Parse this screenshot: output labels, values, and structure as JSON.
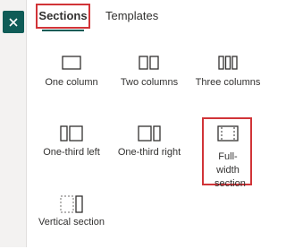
{
  "rail": {
    "close_label": "×"
  },
  "tabs": [
    {
      "label": "Sections",
      "selected": true
    },
    {
      "label": "Templates",
      "selected": false
    }
  ],
  "tiles": [
    {
      "label": "One column",
      "icon": "one-column-icon"
    },
    {
      "label": "Two columns",
      "icon": "two-columns-icon"
    },
    {
      "label": "Three columns",
      "icon": "three-columns-icon"
    },
    {
      "label": "One-third left",
      "icon": "one-third-left-icon"
    },
    {
      "label": "One-third right",
      "icon": "one-third-right-icon"
    },
    {
      "label": "Full-width section",
      "icon": "full-width-section-icon",
      "highlighted": true
    },
    {
      "label": "Vertical section",
      "icon": "vertical-section-icon"
    }
  ],
  "colors": {
    "accent": "#0f5c57",
    "highlight": "#d13438",
    "icon": "#323130"
  }
}
